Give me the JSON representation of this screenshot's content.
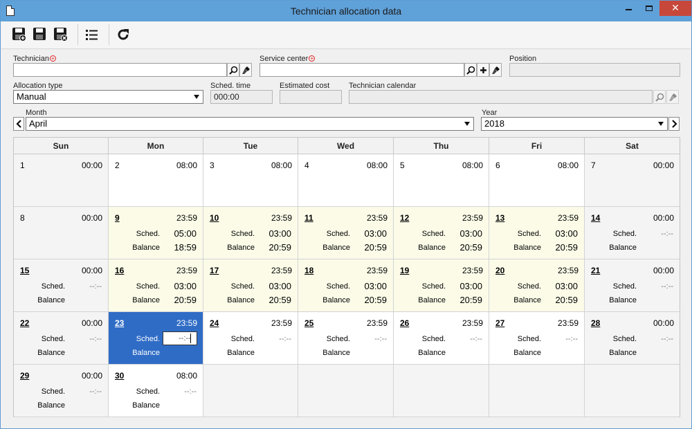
{
  "window": {
    "title": "Technician allocation data"
  },
  "toolbar": {
    "save_new_label": "Save and new",
    "save_label": "Save",
    "save_close_label": "Save and close",
    "list_label": "List",
    "refresh_label": "Refresh"
  },
  "form": {
    "technician_label": "Technician",
    "technician_value": "",
    "service_center_label": "Service center",
    "service_center_value": "",
    "position_label": "Position",
    "position_value": "",
    "allocation_type_label": "Allocation type",
    "allocation_type_value": "Manual",
    "sched_time_label": "Sched. time",
    "sched_time_value": "000:00",
    "estimated_cost_label": "Estimated cost",
    "estimated_cost_value": "",
    "technician_calendar_label": "Technician calendar",
    "technician_calendar_value": "",
    "month_label": "Month",
    "month_value": "April",
    "year_label": "Year",
    "year_value": "2018"
  },
  "calendar": {
    "weekdays": [
      "Sun",
      "Mon",
      "Tue",
      "Wed",
      "Thu",
      "Fri",
      "Sat"
    ],
    "sched_label": "Sched.",
    "balance_label": "Balance",
    "weeks": [
      [
        {
          "day": "1",
          "hours": "00:00",
          "style": "gray"
        },
        {
          "day": "2",
          "hours": "08:00",
          "style": "white"
        },
        {
          "day": "3",
          "hours": "08:00",
          "style": "white"
        },
        {
          "day": "4",
          "hours": "08:00",
          "style": "white"
        },
        {
          "day": "5",
          "hours": "08:00",
          "style": "white"
        },
        {
          "day": "6",
          "hours": "08:00",
          "style": "white"
        },
        {
          "day": "7",
          "hours": "00:00",
          "style": "gray"
        }
      ],
      [
        {
          "day": "8",
          "hours": "00:00",
          "style": "gray"
        },
        {
          "day": "9",
          "hours": "23:59",
          "style": "yellow",
          "ul": true,
          "sched": "05:00",
          "balance": "18:59"
        },
        {
          "day": "10",
          "hours": "23:59",
          "style": "yellow",
          "ul": true,
          "sched": "03:00",
          "balance": "20:59"
        },
        {
          "day": "11",
          "hours": "23:59",
          "style": "yellow",
          "ul": true,
          "sched": "03:00",
          "balance": "20:59"
        },
        {
          "day": "12",
          "hours": "23:59",
          "style": "yellow",
          "ul": true,
          "sched": "03:00",
          "balance": "20:59"
        },
        {
          "day": "13",
          "hours": "23:59",
          "style": "yellow",
          "ul": true,
          "sched": "03:00",
          "balance": "20:59"
        },
        {
          "day": "14",
          "hours": "00:00",
          "style": "gray",
          "ul": true,
          "sched": "--:--",
          "balance": ""
        }
      ],
      [
        {
          "day": "15",
          "hours": "00:00",
          "style": "gray",
          "ul": true,
          "sched": "--:--",
          "balance": ""
        },
        {
          "day": "16",
          "hours": "23:59",
          "style": "yellow",
          "ul": true,
          "sched": "03:00",
          "balance": "20:59"
        },
        {
          "day": "17",
          "hours": "23:59",
          "style": "yellow",
          "ul": true,
          "sched": "03:00",
          "balance": "20:59"
        },
        {
          "day": "18",
          "hours": "23:59",
          "style": "yellow",
          "ul": true,
          "sched": "03:00",
          "balance": "20:59"
        },
        {
          "day": "19",
          "hours": "23:59",
          "style": "yellow",
          "ul": true,
          "sched": "03:00",
          "balance": "20:59"
        },
        {
          "day": "20",
          "hours": "23:59",
          "style": "yellow",
          "ul": true,
          "sched": "03:00",
          "balance": "20:59"
        },
        {
          "day": "21",
          "hours": "00:00",
          "style": "gray",
          "ul": true,
          "sched": "--:--",
          "balance": ""
        }
      ],
      [
        {
          "day": "22",
          "hours": "00:00",
          "style": "gray",
          "ul": true,
          "sched": "--:--",
          "balance": ""
        },
        {
          "day": "23",
          "hours": "23:59",
          "style": "sel",
          "ul": true,
          "sched": "--:--",
          "balance": ""
        },
        {
          "day": "24",
          "hours": "23:59",
          "style": "white",
          "ul": true,
          "sched": "--:--",
          "balance": ""
        },
        {
          "day": "25",
          "hours": "23:59",
          "style": "white",
          "ul": true,
          "sched": "--:--",
          "balance": ""
        },
        {
          "day": "26",
          "hours": "23:59",
          "style": "white",
          "ul": true,
          "sched": "--:--",
          "balance": ""
        },
        {
          "day": "27",
          "hours": "23:59",
          "style": "white",
          "ul": true,
          "sched": "--:--",
          "balance": ""
        },
        {
          "day": "28",
          "hours": "00:00",
          "style": "gray",
          "ul": true,
          "sched": "--:--",
          "balance": ""
        }
      ],
      [
        {
          "day": "29",
          "hours": "00:00",
          "style": "gray",
          "ul": true,
          "sched": "--:--",
          "balance": ""
        },
        {
          "day": "30",
          "hours": "08:00",
          "style": "white",
          "ul": true,
          "sched": "--:--",
          "balance": ""
        },
        {
          "style": "empty"
        },
        {
          "style": "empty"
        },
        {
          "style": "empty"
        },
        {
          "style": "empty"
        },
        {
          "style": "empty"
        }
      ]
    ]
  }
}
